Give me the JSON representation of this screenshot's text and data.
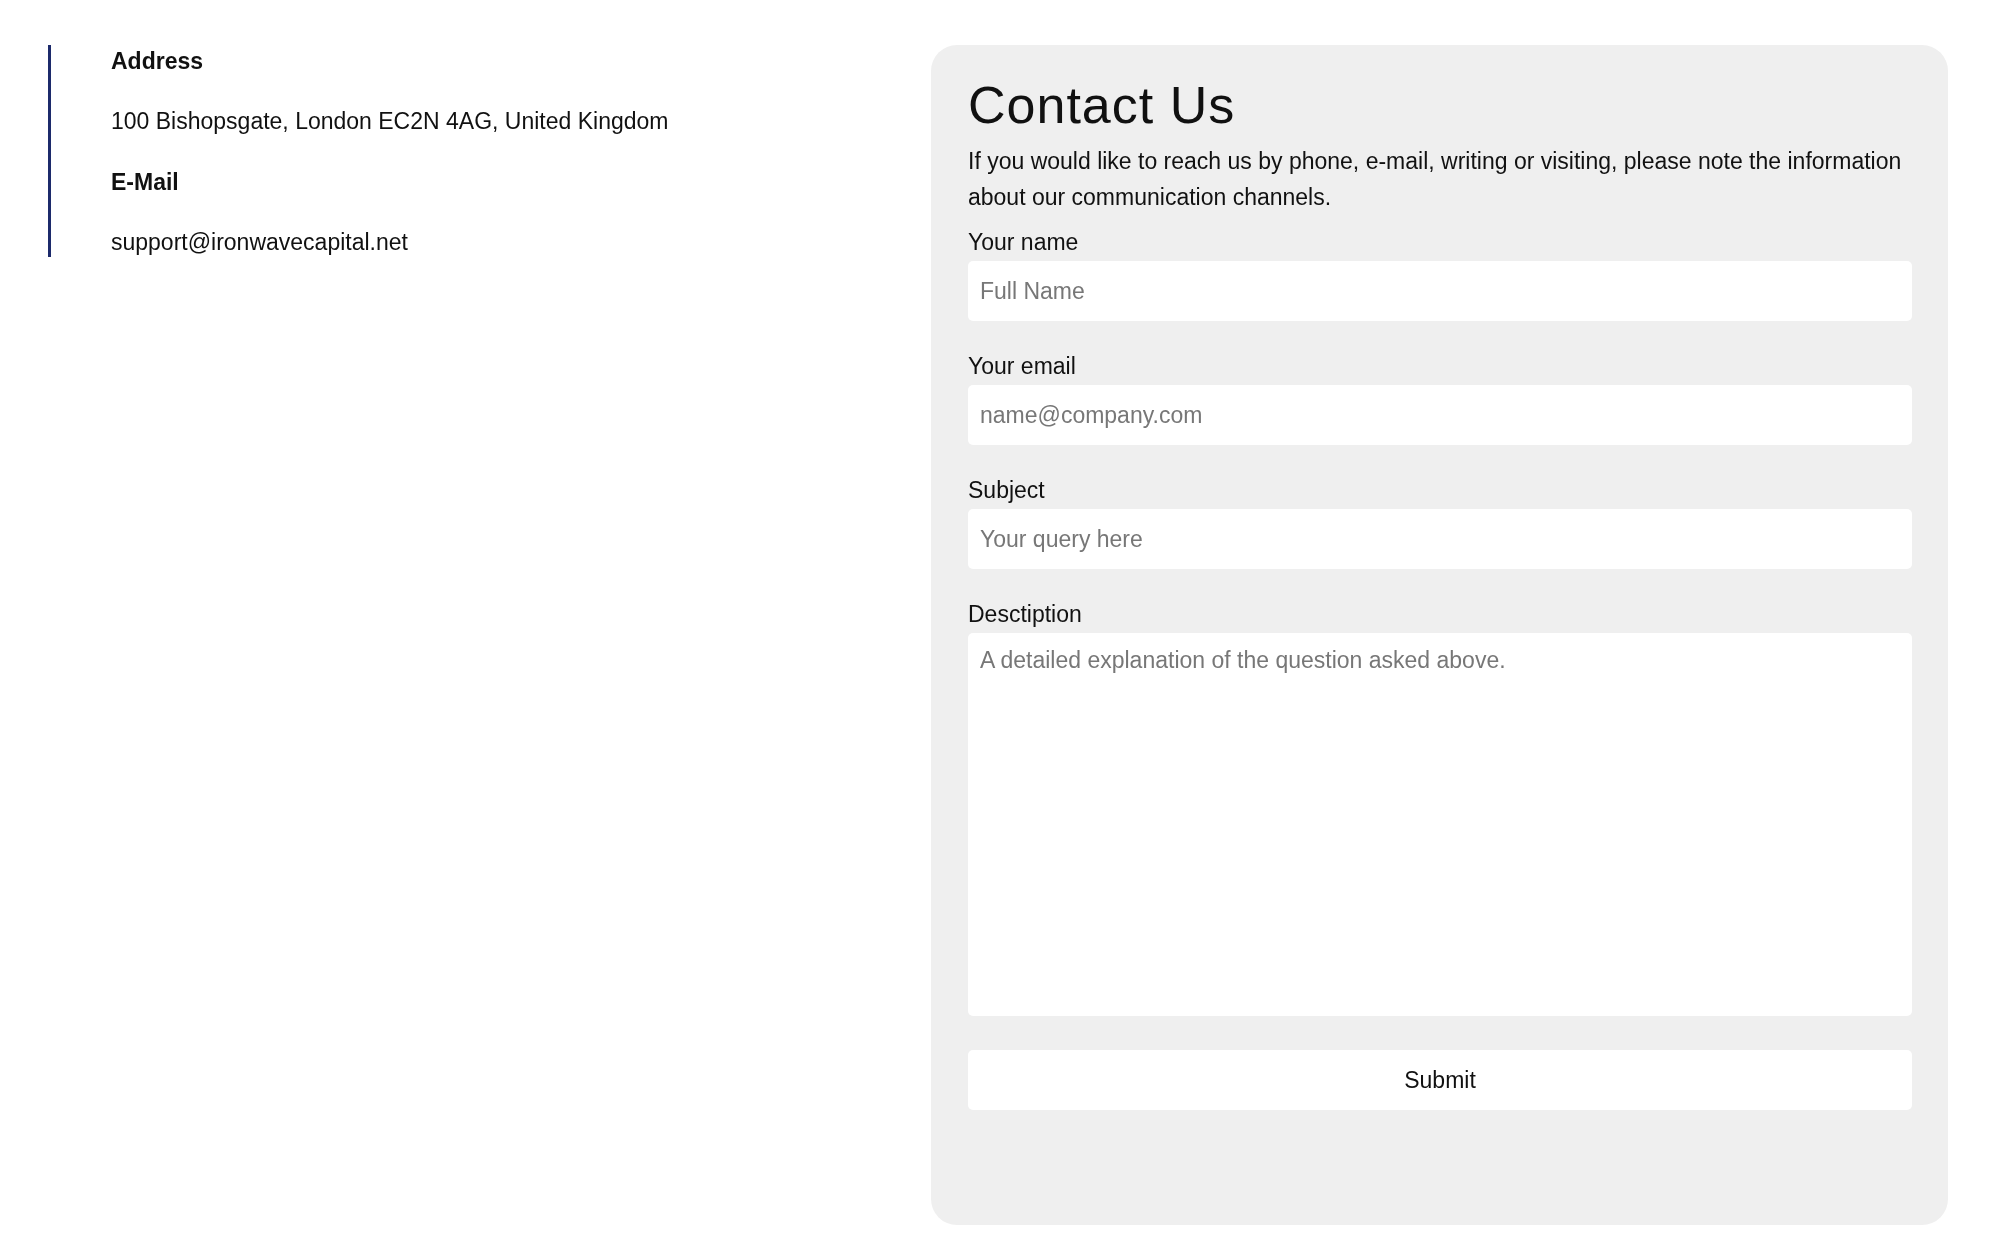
{
  "contact_info": [
    {
      "heading": "Address",
      "value": "100 Bishopsgate, London EC2N 4AG, United Kingdom"
    },
    {
      "heading": "E-Mail",
      "value": "support@ironwavecapital.net"
    }
  ],
  "form": {
    "title": "Contact Us",
    "intro": "If you would like to reach us by phone, e-mail, writing or visiting, please note the information about our communication channels.",
    "fields": [
      {
        "kind": "input",
        "label": "Your name",
        "placeholder": "Full Name"
      },
      {
        "kind": "input",
        "label": "Your email",
        "placeholder": "name@company.com"
      },
      {
        "kind": "input",
        "label": "Subject",
        "placeholder": "Your query here"
      },
      {
        "kind": "textarea",
        "label": "Desctiption",
        "placeholder": "A detailed explanation of the question asked above."
      }
    ],
    "submit": "Submit"
  }
}
